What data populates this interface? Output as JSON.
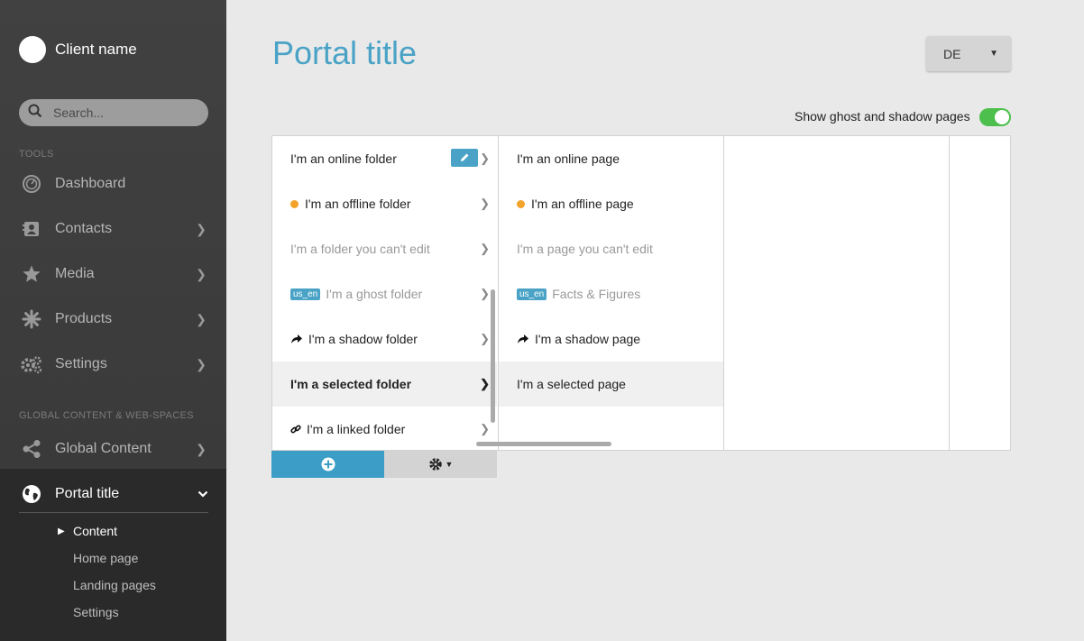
{
  "sidebar": {
    "client_name": "Client name",
    "search_placeholder": "Search...",
    "tools_heading": "TOOLS",
    "tools": [
      {
        "label": "Dashboard",
        "icon": "dashboard-icon"
      },
      {
        "label": "Contacts",
        "icon": "contacts-icon"
      },
      {
        "label": "Media",
        "icon": "star-icon"
      },
      {
        "label": "Products",
        "icon": "products-icon"
      },
      {
        "label": "Settings",
        "icon": "gears-icon"
      }
    ],
    "global_heading": "GLOBAL CONTENT & WEB-SPACES",
    "global_content_label": "Global Content",
    "portal": {
      "label": "Portal title",
      "sub_items": [
        "Content",
        "Home page",
        "Landing pages",
        "Settings"
      ],
      "active_sub": "Content"
    }
  },
  "header": {
    "title": "Portal title",
    "language": "DE",
    "ghost_toggle_label": "Show ghost and shadow pages",
    "ghost_toggle_on": true
  },
  "columns": {
    "folders": [
      {
        "label": "I'm an online folder"
      },
      {
        "label": "I'm an offline folder"
      },
      {
        "label": "I'm a folder you can't edit"
      },
      {
        "label": "I'm a ghost folder",
        "badge": "us_en"
      },
      {
        "label": "I'm a shadow folder"
      },
      {
        "label": "I'm a selected folder"
      },
      {
        "label": "I'm a linked folder"
      }
    ],
    "pages": [
      {
        "label": "I'm an online page"
      },
      {
        "label": "I'm an offline page"
      },
      {
        "label": "I'm a page you can't edit"
      },
      {
        "label": "Facts & Figures",
        "badge": "us_en"
      },
      {
        "label": "I'm a shadow page"
      },
      {
        "label": "I'm a selected page"
      }
    ]
  },
  "colors": {
    "accent": "#4aa3c6",
    "offline_dot": "#f3a32a",
    "toggle_on": "#4cbf4c"
  }
}
